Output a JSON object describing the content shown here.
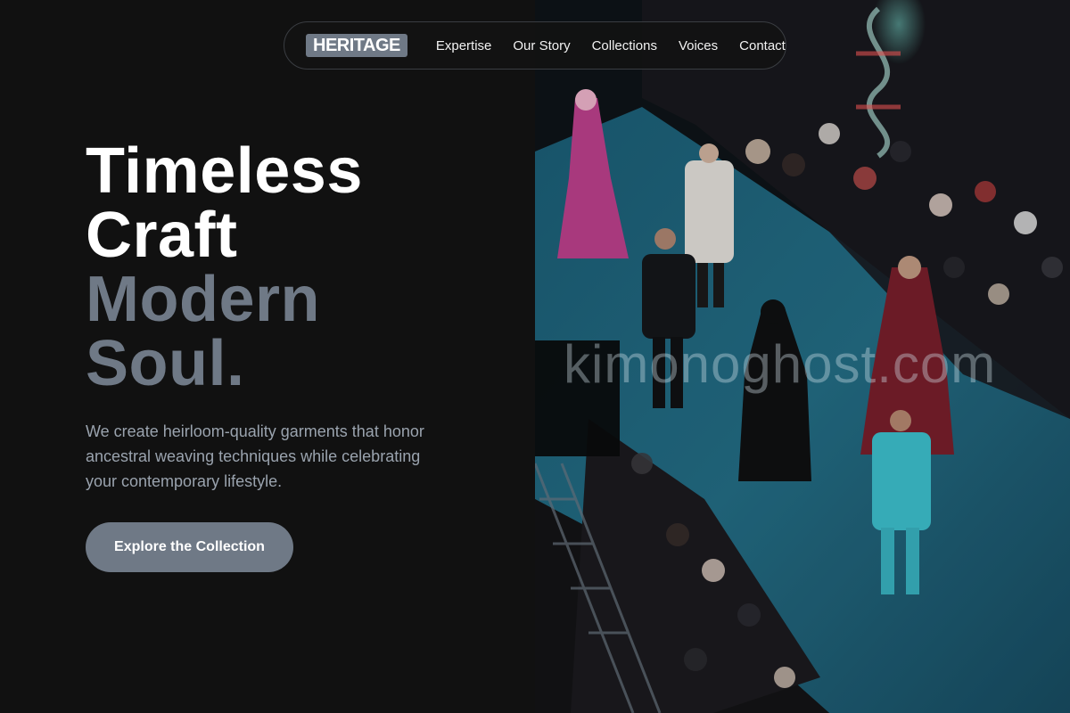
{
  "nav": {
    "logo": "HERITAGE",
    "links": [
      "Expertise",
      "Our Story",
      "Collections",
      "Voices",
      "Contact"
    ]
  },
  "hero": {
    "headline": [
      "Timeless",
      "Craft",
      "Modern",
      "Soul."
    ],
    "lead": "We create heirloom-quality garments that honor ancestral weaving techniques while celebrating your contemporary lifestyle.",
    "cta_label": "Explore the Collection"
  },
  "photo": {
    "watermark": "kimonoghost.com"
  },
  "colors": {
    "background": "#111111",
    "accent_gray": "#6f7986",
    "lead_text": "#9aa3ae",
    "runway_blue": "#1f6e86"
  }
}
